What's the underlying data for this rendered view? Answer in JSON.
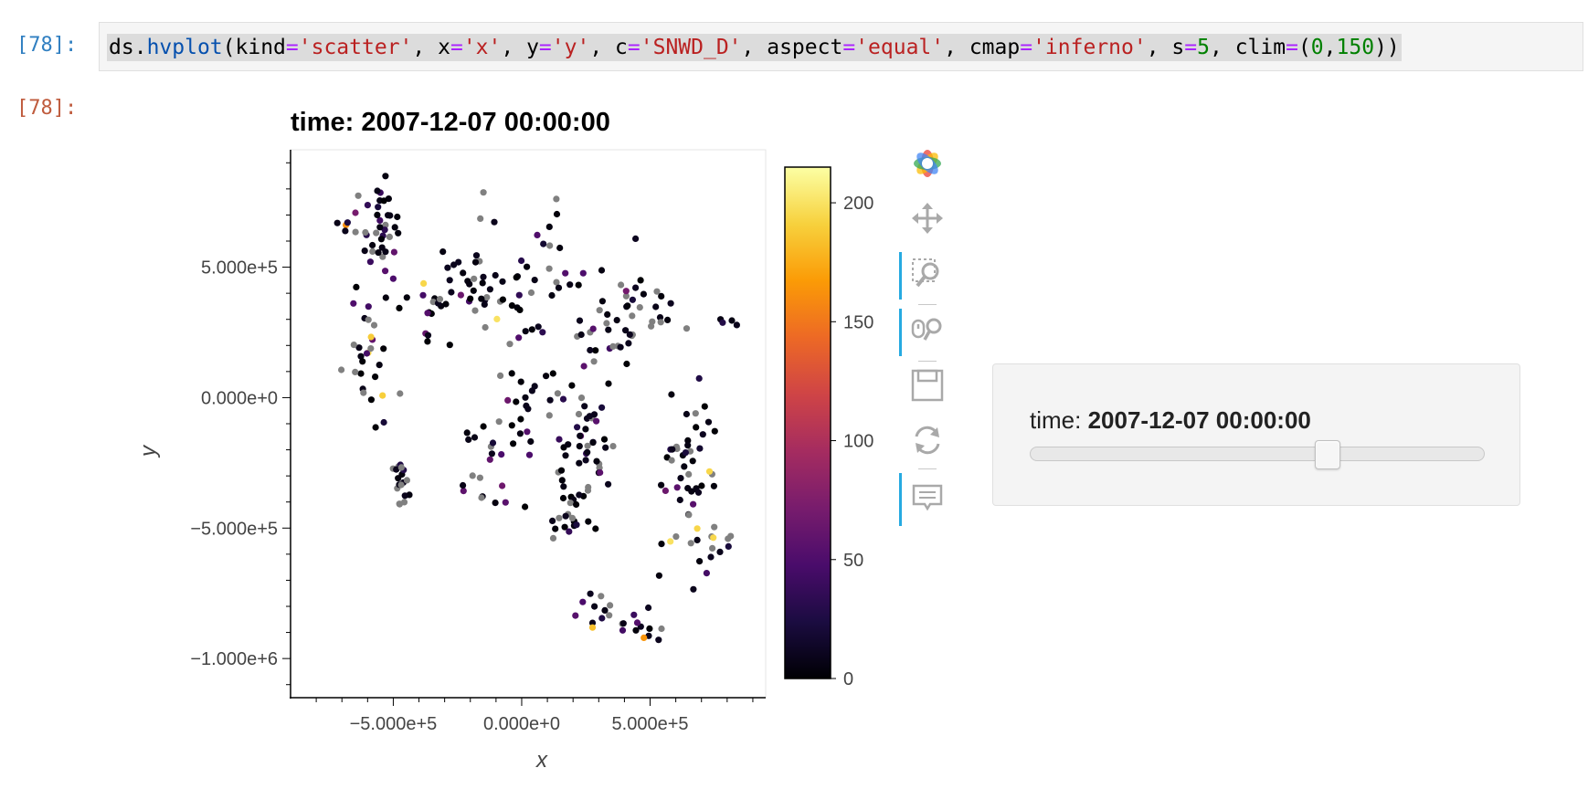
{
  "notebook": {
    "input_prompt": "[78]:",
    "output_prompt": "[78]:",
    "code_tokens": [
      {
        "t": "ds",
        "c": "tk-name"
      },
      {
        "t": ".",
        "c": "tk-name"
      },
      {
        "t": "hvplot",
        "c": "tk-attr"
      },
      {
        "t": "(",
        "c": "tk-name"
      },
      {
        "t": "kind",
        "c": "tk-name"
      },
      {
        "t": "=",
        "c": "tk-op"
      },
      {
        "t": "'scatter'",
        "c": "tk-str"
      },
      {
        "t": ", ",
        "c": "tk-name"
      },
      {
        "t": "x",
        "c": "tk-name"
      },
      {
        "t": "=",
        "c": "tk-op"
      },
      {
        "t": "'x'",
        "c": "tk-str"
      },
      {
        "t": ", ",
        "c": "tk-name"
      },
      {
        "t": "y",
        "c": "tk-name"
      },
      {
        "t": "=",
        "c": "tk-op"
      },
      {
        "t": "'y'",
        "c": "tk-str"
      },
      {
        "t": ", ",
        "c": "tk-name"
      },
      {
        "t": "c",
        "c": "tk-name"
      },
      {
        "t": "=",
        "c": "tk-op"
      },
      {
        "t": "'SNWD_D'",
        "c": "tk-str"
      },
      {
        "t": ", ",
        "c": "tk-name"
      },
      {
        "t": "aspect",
        "c": "tk-name"
      },
      {
        "t": "=",
        "c": "tk-op"
      },
      {
        "t": "'equal'",
        "c": "tk-str"
      },
      {
        "t": ", ",
        "c": "tk-name"
      },
      {
        "t": "cmap",
        "c": "tk-name"
      },
      {
        "t": "=",
        "c": "tk-op"
      },
      {
        "t": "'inferno'",
        "c": "tk-str"
      },
      {
        "t": ", ",
        "c": "tk-name"
      },
      {
        "t": "s",
        "c": "tk-name"
      },
      {
        "t": "=",
        "c": "tk-op"
      },
      {
        "t": "5",
        "c": "tk-num"
      },
      {
        "t": ", ",
        "c": "tk-name"
      },
      {
        "t": "clim",
        "c": "tk-name"
      },
      {
        "t": "=",
        "c": "tk-op"
      },
      {
        "t": "(",
        "c": "tk-name"
      },
      {
        "t": "0",
        "c": "tk-num"
      },
      {
        "t": ",",
        "c": "tk-name"
      },
      {
        "t": "150",
        "c": "tk-num"
      },
      {
        "t": "))",
        "c": "tk-name"
      }
    ]
  },
  "toolbar": {
    "tools": [
      {
        "name": "bokeh-logo-icon",
        "active": false
      },
      {
        "name": "pan-icon",
        "active": false
      },
      {
        "name": "box-zoom-icon",
        "active": true
      },
      {
        "name": "wheel-zoom-icon",
        "active": true
      },
      {
        "name": "save-icon",
        "active": false
      },
      {
        "name": "reset-icon",
        "active": false
      },
      {
        "name": "hover-icon",
        "active": true
      }
    ]
  },
  "widget": {
    "label_prefix": "time: ",
    "label_value": "2007-12-07 00:00:00",
    "slider_fraction": 0.655
  },
  "chart_data": {
    "type": "scatter",
    "title": "time: 2007-12-07 00:00:00",
    "xlabel": "x",
    "ylabel": "y",
    "xlim": [
      -900000,
      950000
    ],
    "ylim": [
      -1150000,
      950000
    ],
    "x_ticks": [
      {
        "value": -500000,
        "label": "−5.000e+5"
      },
      {
        "value": 0,
        "label": "0.000e+0"
      },
      {
        "value": 500000,
        "label": "5.000e+5"
      }
    ],
    "y_ticks": [
      {
        "value": -1000000,
        "label": "−1.000e+6"
      },
      {
        "value": -500000,
        "label": "−5.000e+5"
      },
      {
        "value": 0,
        "label": "0.000e+0"
      },
      {
        "value": 500000,
        "label": "5.000e+5"
      }
    ],
    "colorbar": {
      "cmap": "inferno",
      "range": [
        0,
        215
      ],
      "ticks": [
        0,
        50,
        100,
        150,
        200
      ],
      "colors": [
        "#000004",
        "#1b0c41",
        "#4a0c6b",
        "#781c6d",
        "#a52c60",
        "#cf4446",
        "#ed6925",
        "#fb9b06",
        "#f7d13d",
        "#fcffa4"
      ]
    },
    "nan_color": "#808080",
    "clusters": [
      {
        "cx": -540000,
        "cy": 650000,
        "sx": 40000,
        "sy": 110000,
        "n": 35
      },
      {
        "cx": -590000,
        "cy": 180000,
        "sx": 60000,
        "sy": 130000,
        "n": 30
      },
      {
        "cx": -470000,
        "cy": -330000,
        "sx": 25000,
        "sy": 50000,
        "n": 18
      },
      {
        "cx": -380000,
        "cy": 330000,
        "sx": 70000,
        "sy": 50000,
        "n": 15
      },
      {
        "cx": -170000,
        "cy": 470000,
        "sx": 90000,
        "sy": 110000,
        "n": 30
      },
      {
        "cx": 40000,
        "cy": 380000,
        "sx": 120000,
        "sy": 140000,
        "n": 40
      },
      {
        "cx": 50000,
        "cy": -80000,
        "sx": 50000,
        "sy": 70000,
        "n": 15
      },
      {
        "cx": -100000,
        "cy": -150000,
        "sx": 50000,
        "sy": 90000,
        "n": 15
      },
      {
        "cx": 250000,
        "cy": -170000,
        "sx": 60000,
        "sy": 180000,
        "n": 60
      },
      {
        "cx": 350000,
        "cy": 280000,
        "sx": 80000,
        "sy": 110000,
        "n": 30
      },
      {
        "cx": 550000,
        "cy": 300000,
        "sx": 30000,
        "sy": 60000,
        "n": 10
      },
      {
        "cx": 660000,
        "cy": -250000,
        "sx": 55000,
        "sy": 170000,
        "n": 50
      },
      {
        "cx": 760000,
        "cy": -570000,
        "sx": 30000,
        "sy": 50000,
        "n": 10
      },
      {
        "cx": 280000,
        "cy": -800000,
        "sx": 40000,
        "sy": 60000,
        "n": 12
      },
      {
        "cx": 480000,
        "cy": -900000,
        "sx": 50000,
        "sy": 30000,
        "n": 12
      },
      {
        "cx": 170000,
        "cy": -480000,
        "sx": 80000,
        "sy": 30000,
        "n": 14
      },
      {
        "cx": -120000,
        "cy": -380000,
        "sx": 60000,
        "sy": 40000,
        "n": 8
      },
      {
        "cx": -680000,
        "cy": 650000,
        "sx": 20000,
        "sy": 40000,
        "n": 6
      },
      {
        "cx": 780000,
        "cy": 300000,
        "sx": 30000,
        "sy": 20000,
        "n": 4
      }
    ]
  }
}
